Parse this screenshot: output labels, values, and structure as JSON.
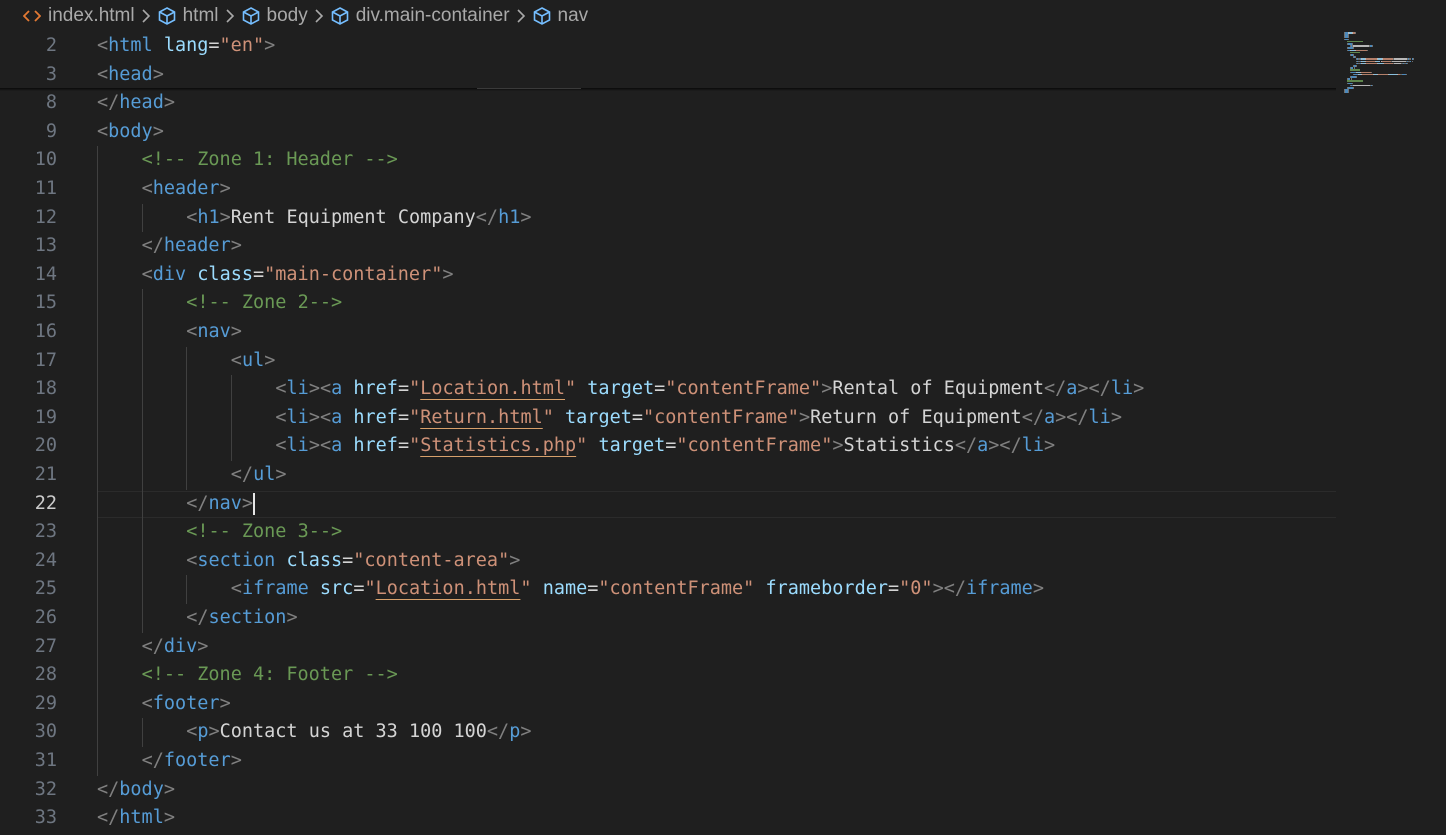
{
  "breadcrumb": {
    "items": [
      {
        "label": "index.html",
        "icon": "html-file-icon"
      },
      {
        "label": "html",
        "icon": "symbol-element-icon"
      },
      {
        "label": "body",
        "icon": "symbol-element-icon"
      },
      {
        "label": "div.main-container",
        "icon": "symbol-element-icon"
      },
      {
        "label": "nav",
        "icon": "symbol-element-icon"
      }
    ],
    "separator_icon": "chevron-right-icon"
  },
  "editor": {
    "active_line": 22,
    "lines": [
      {
        "n": "2",
        "indent": 0,
        "tokens": [
          [
            "br",
            "<"
          ],
          [
            "tag",
            "html"
          ],
          [
            "txt",
            " "
          ],
          [
            "attr",
            "lang"
          ],
          [
            "txt",
            "="
          ],
          [
            "str",
            "\"en\""
          ],
          [
            "br",
            ">"
          ]
        ]
      },
      {
        "n": "3",
        "indent": 0,
        "tokens": [
          [
            "br",
            "<"
          ],
          [
            "tag",
            "head"
          ],
          [
            "br",
            ">"
          ]
        ]
      },
      {
        "n": "8",
        "indent": 0,
        "tokens": [
          [
            "br",
            "</"
          ],
          [
            "tag",
            "head"
          ],
          [
            "br",
            ">"
          ]
        ]
      },
      {
        "n": "9",
        "indent": 0,
        "tokens": [
          [
            "br",
            "<"
          ],
          [
            "tag",
            "body"
          ],
          [
            "br",
            ">"
          ]
        ]
      },
      {
        "n": "10",
        "indent": 1,
        "tokens": [
          [
            "cmt",
            "<!-- Zone 1: Header -->"
          ]
        ]
      },
      {
        "n": "11",
        "indent": 1,
        "tokens": [
          [
            "br",
            "<"
          ],
          [
            "tag",
            "header"
          ],
          [
            "br",
            ">"
          ]
        ]
      },
      {
        "n": "12",
        "indent": 2,
        "tokens": [
          [
            "br",
            "<"
          ],
          [
            "tag",
            "h1"
          ],
          [
            "br",
            ">"
          ],
          [
            "txt",
            "Rent Equipment Company"
          ],
          [
            "br",
            "</"
          ],
          [
            "tag",
            "h1"
          ],
          [
            "br",
            ">"
          ]
        ]
      },
      {
        "n": "13",
        "indent": 1,
        "tokens": [
          [
            "br",
            "</"
          ],
          [
            "tag",
            "header"
          ],
          [
            "br",
            ">"
          ]
        ]
      },
      {
        "n": "14",
        "indent": 1,
        "tokens": [
          [
            "br",
            "<"
          ],
          [
            "tag",
            "div"
          ],
          [
            "txt",
            " "
          ],
          [
            "attr",
            "class"
          ],
          [
            "txt",
            "="
          ],
          [
            "str",
            "\"main-container\""
          ],
          [
            "br",
            ">"
          ]
        ]
      },
      {
        "n": "15",
        "indent": 2,
        "tokens": [
          [
            "cmt",
            "<!-- Zone 2-->"
          ]
        ]
      },
      {
        "n": "16",
        "indent": 2,
        "tokens": [
          [
            "br",
            "<"
          ],
          [
            "tag",
            "nav"
          ],
          [
            "br",
            ">"
          ]
        ]
      },
      {
        "n": "17",
        "indent": 3,
        "tokens": [
          [
            "br",
            "<"
          ],
          [
            "tag",
            "ul"
          ],
          [
            "br",
            ">"
          ]
        ]
      },
      {
        "n": "18",
        "indent": 4,
        "tokens": [
          [
            "br",
            "<"
          ],
          [
            "tag",
            "li"
          ],
          [
            "br",
            "><"
          ],
          [
            "tag",
            "a"
          ],
          [
            "txt",
            " "
          ],
          [
            "attr",
            "href"
          ],
          [
            "txt",
            "="
          ],
          [
            "str",
            "\""
          ],
          [
            "strlink",
            "Location.html"
          ],
          [
            "str",
            "\""
          ],
          [
            "txt",
            " "
          ],
          [
            "attr",
            "target"
          ],
          [
            "txt",
            "="
          ],
          [
            "str",
            "\"contentFrame\""
          ],
          [
            "br",
            ">"
          ],
          [
            "txt",
            "Rental of Equipment"
          ],
          [
            "br",
            "</"
          ],
          [
            "tag",
            "a"
          ],
          [
            "br",
            "></"
          ],
          [
            "tag",
            "li"
          ],
          [
            "br",
            ">"
          ]
        ]
      },
      {
        "n": "19",
        "indent": 4,
        "tokens": [
          [
            "br",
            "<"
          ],
          [
            "tag",
            "li"
          ],
          [
            "br",
            "><"
          ],
          [
            "tag",
            "a"
          ],
          [
            "txt",
            " "
          ],
          [
            "attr",
            "href"
          ],
          [
            "txt",
            "="
          ],
          [
            "str",
            "\""
          ],
          [
            "strlink",
            "Return.html"
          ],
          [
            "str",
            "\""
          ],
          [
            "txt",
            " "
          ],
          [
            "attr",
            "target"
          ],
          [
            "txt",
            "="
          ],
          [
            "str",
            "\"contentFrame\""
          ],
          [
            "br",
            ">"
          ],
          [
            "txt",
            "Return of Equipment"
          ],
          [
            "br",
            "</"
          ],
          [
            "tag",
            "a"
          ],
          [
            "br",
            "></"
          ],
          [
            "tag",
            "li"
          ],
          [
            "br",
            ">"
          ]
        ]
      },
      {
        "n": "20",
        "indent": 4,
        "tokens": [
          [
            "br",
            "<"
          ],
          [
            "tag",
            "li"
          ],
          [
            "br",
            "><"
          ],
          [
            "tag",
            "a"
          ],
          [
            "txt",
            " "
          ],
          [
            "attr",
            "href"
          ],
          [
            "txt",
            "="
          ],
          [
            "str",
            "\""
          ],
          [
            "strlink",
            "Statistics.php"
          ],
          [
            "str",
            "\""
          ],
          [
            "txt",
            " "
          ],
          [
            "attr",
            "target"
          ],
          [
            "txt",
            "="
          ],
          [
            "str",
            "\"contentFrame\""
          ],
          [
            "br",
            ">"
          ],
          [
            "txt",
            "Statistics"
          ],
          [
            "br",
            "</"
          ],
          [
            "tag",
            "a"
          ],
          [
            "br",
            "></"
          ],
          [
            "tag",
            "li"
          ],
          [
            "br",
            ">"
          ]
        ]
      },
      {
        "n": "21",
        "indent": 3,
        "tokens": [
          [
            "br",
            "</"
          ],
          [
            "tag",
            "ul"
          ],
          [
            "br",
            ">"
          ]
        ]
      },
      {
        "n": "22",
        "indent": 2,
        "tokens": [
          [
            "br",
            "</"
          ],
          [
            "tag",
            "nav"
          ],
          [
            "br",
            ">"
          ]
        ]
      },
      {
        "n": "23",
        "indent": 2,
        "tokens": [
          [
            "cmt",
            "<!-- Zone 3-->"
          ]
        ]
      },
      {
        "n": "24",
        "indent": 2,
        "tokens": [
          [
            "br",
            "<"
          ],
          [
            "tag",
            "section"
          ],
          [
            "txt",
            " "
          ],
          [
            "attr",
            "class"
          ],
          [
            "txt",
            "="
          ],
          [
            "str",
            "\"content-area\""
          ],
          [
            "br",
            ">"
          ]
        ]
      },
      {
        "n": "25",
        "indent": 3,
        "tokens": [
          [
            "br",
            "<"
          ],
          [
            "tag",
            "iframe"
          ],
          [
            "txt",
            " "
          ],
          [
            "attr",
            "src"
          ],
          [
            "txt",
            "="
          ],
          [
            "str",
            "\""
          ],
          [
            "strlink",
            "Location.html"
          ],
          [
            "str",
            "\""
          ],
          [
            "txt",
            " "
          ],
          [
            "attr",
            "name"
          ],
          [
            "txt",
            "="
          ],
          [
            "str",
            "\"contentFrame\""
          ],
          [
            "txt",
            " "
          ],
          [
            "attr",
            "frameborder"
          ],
          [
            "txt",
            "="
          ],
          [
            "str",
            "\"0\""
          ],
          [
            "br",
            "></"
          ],
          [
            "tag",
            "iframe"
          ],
          [
            "br",
            ">"
          ]
        ]
      },
      {
        "n": "26",
        "indent": 2,
        "tokens": [
          [
            "br",
            "</"
          ],
          [
            "tag",
            "section"
          ],
          [
            "br",
            ">"
          ]
        ]
      },
      {
        "n": "27",
        "indent": 1,
        "tokens": [
          [
            "br",
            "</"
          ],
          [
            "tag",
            "div"
          ],
          [
            "br",
            ">"
          ]
        ]
      },
      {
        "n": "28",
        "indent": 1,
        "tokens": [
          [
            "cmt",
            "<!-- Zone 4: Footer -->"
          ]
        ]
      },
      {
        "n": "29",
        "indent": 1,
        "tokens": [
          [
            "br",
            "<"
          ],
          [
            "tag",
            "footer"
          ],
          [
            "br",
            ">"
          ]
        ]
      },
      {
        "n": "30",
        "indent": 2,
        "tokens": [
          [
            "br",
            "<"
          ],
          [
            "tag",
            "p"
          ],
          [
            "br",
            ">"
          ],
          [
            "txt",
            "Contact us at 33 100 100"
          ],
          [
            "br",
            "</"
          ],
          [
            "tag",
            "p"
          ],
          [
            "br",
            ">"
          ]
        ]
      },
      {
        "n": "31",
        "indent": 1,
        "tokens": [
          [
            "br",
            "</"
          ],
          [
            "tag",
            "footer"
          ],
          [
            "br",
            ">"
          ]
        ]
      },
      {
        "n": "32",
        "indent": 0,
        "tokens": [
          [
            "br",
            "</"
          ],
          [
            "tag",
            "body"
          ],
          [
            "br",
            ">"
          ]
        ]
      },
      {
        "n": "33",
        "indent": 0,
        "tokens": [
          [
            "br",
            "</"
          ],
          [
            "tag",
            "html"
          ],
          [
            "br",
            ">"
          ]
        ]
      }
    ]
  },
  "colors": {
    "background": "#1f1f1f",
    "tag": "#569cd6",
    "bracket": "#808080",
    "attribute": "#9cdcfe",
    "string": "#ce9178",
    "comment": "#6a9955",
    "text": "#d4d4d4",
    "line_number": "#6e7681",
    "active_line_number": "#cccccc"
  }
}
